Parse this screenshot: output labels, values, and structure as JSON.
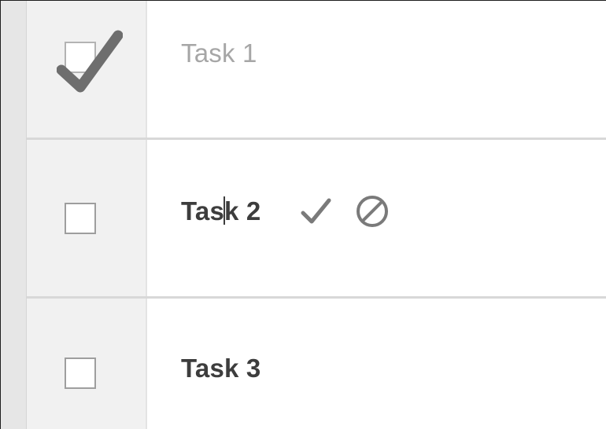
{
  "tasks": [
    {
      "label": "Task 1",
      "done": true
    },
    {
      "label_start": "Tas",
      "label_end": "k 2",
      "done": false,
      "editing": true
    },
    {
      "label": "Task 3",
      "done": false
    }
  ],
  "icons": {
    "done_check": "check-icon",
    "confirm": "check-icon",
    "cancel": "cancel-icon"
  },
  "colors": {
    "done_text": "#a6a6a6",
    "active_text": "#3d3d3d",
    "icon": "#7a7a7a",
    "check_cell_bg": "#f1f1f1"
  }
}
